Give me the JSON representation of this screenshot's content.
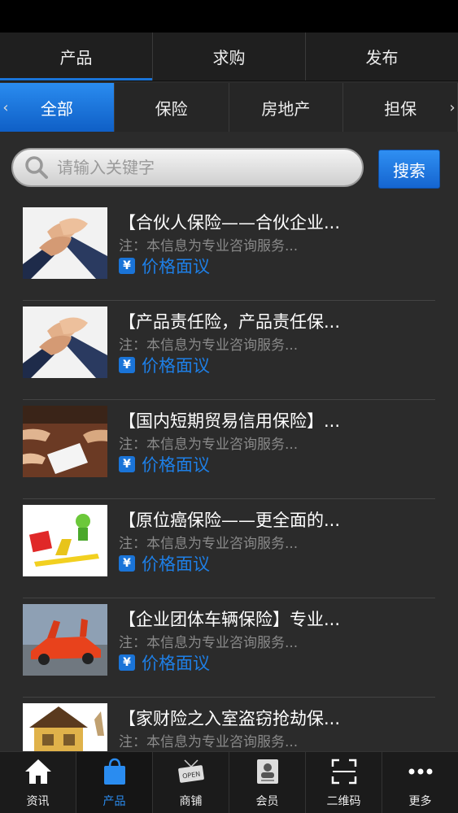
{
  "top_tabs": [
    {
      "label": "产品",
      "active": true
    },
    {
      "label": "求购",
      "active": false
    },
    {
      "label": "发布",
      "active": false
    }
  ],
  "categories": [
    {
      "label": "全部",
      "active": true
    },
    {
      "label": "保险",
      "active": false
    },
    {
      "label": "房地产",
      "active": false
    },
    {
      "label": "担保",
      "active": false
    }
  ],
  "search": {
    "placeholder": "请输入关键字",
    "button_label": "搜索"
  },
  "items": [
    {
      "title": "【合伙人保险——合伙企业...",
      "note": "注：本信息为专业咨询服务...",
      "price": "价格面议",
      "thumb": "hands-icon"
    },
    {
      "title": "【产品责任险，产品责任保...",
      "note": "注：本信息为专业咨询服务...",
      "price": "价格面议",
      "thumb": "hands-icon"
    },
    {
      "title": "【国内短期贸易信用保险】...",
      "note": "注：本信息为专业咨询服务...",
      "price": "价格面议",
      "thumb": "contract-icon"
    },
    {
      "title": "【原位癌保险——更全面的...",
      "note": "注：本信息为专业咨询服务...",
      "price": "价格面议",
      "thumb": "cartoon-icon"
    },
    {
      "title": "【企业团体车辆保险】专业...",
      "note": "注：本信息为专业咨询服务...",
      "price": "价格面议",
      "thumb": "car-icon"
    },
    {
      "title": "【家财险之入室盗窃抢劫保...",
      "note": "注：本信息为专业咨询服务...",
      "price": "",
      "thumb": "house-icon"
    }
  ],
  "bottom_nav": [
    {
      "label": "资讯",
      "icon": "home-icon",
      "active": false
    },
    {
      "label": "产品",
      "icon": "bag-icon",
      "active": true
    },
    {
      "label": "商铺",
      "icon": "shop-sign-icon",
      "active": false
    },
    {
      "label": "会员",
      "icon": "member-card-icon",
      "active": false
    },
    {
      "label": "二维码",
      "icon": "qr-scan-icon",
      "active": false
    },
    {
      "label": "更多",
      "icon": "more-icon",
      "active": false
    }
  ],
  "colors": {
    "accent": "#1a74d8",
    "background": "#2b2b2b"
  }
}
